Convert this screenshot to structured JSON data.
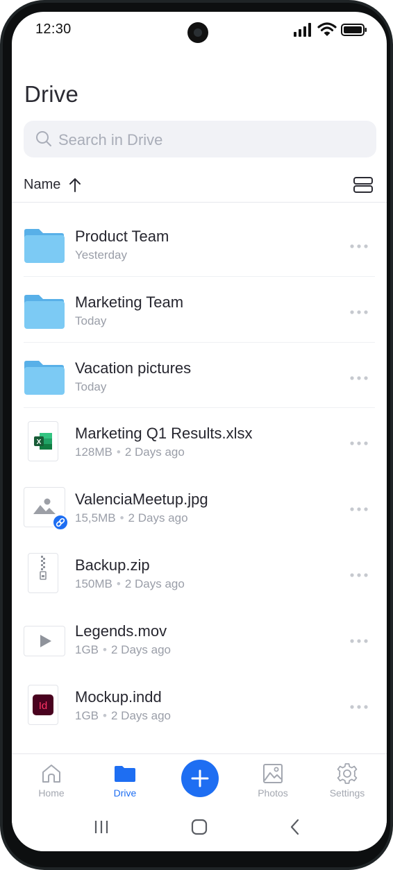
{
  "status_bar": {
    "time": "12:30"
  },
  "header": {
    "title": "Drive"
  },
  "search": {
    "placeholder": "Search in Drive"
  },
  "sort": {
    "label": "Name",
    "direction": "ascending"
  },
  "files": [
    {
      "name": "Product Team",
      "meta": "Yesterday",
      "size": "",
      "type": "folder"
    },
    {
      "name": "Marketing Team",
      "meta": "Today",
      "size": "",
      "type": "folder"
    },
    {
      "name": "Vacation pictures",
      "meta": "Today",
      "size": "",
      "type": "folder"
    },
    {
      "name": "Marketing Q1 Results.xlsx",
      "size": "128MB",
      "meta": "2 Days ago",
      "type": "excel",
      "icon_text": "X"
    },
    {
      "name": "ValenciaMeetup.jpg",
      "size": "15,5MB",
      "meta": "2 Days ago",
      "type": "image",
      "shared": true
    },
    {
      "name": "Backup.zip",
      "size": "150MB",
      "meta": "2 Days ago",
      "type": "zip"
    },
    {
      "name": "Legends.mov",
      "size": "1GB",
      "meta": "2 Days ago",
      "type": "video"
    },
    {
      "name": "Mockup.indd",
      "size": "1GB",
      "meta": "2 Days ago",
      "type": "indesign",
      "icon_text": "Id"
    }
  ],
  "tabs": [
    {
      "label": "Home",
      "icon": "home-icon",
      "active": false
    },
    {
      "label": "Drive",
      "icon": "folder-icon",
      "active": true
    },
    {
      "label": "Photos",
      "icon": "image-icon",
      "active": false
    },
    {
      "label": "Settings",
      "icon": "gear-icon",
      "active": false
    }
  ],
  "colors": {
    "accent": "#1e6ef2",
    "folder": "#6cc0f0",
    "excel_green": "#1d7044",
    "indesign_bg": "#49021f",
    "indesign_text": "#ff3366"
  }
}
